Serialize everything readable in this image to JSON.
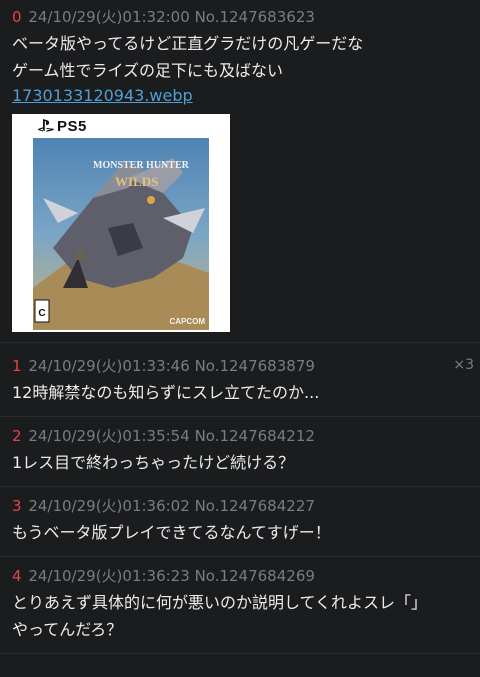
{
  "posts": [
    {
      "index": "0",
      "date": "24/10/29(火)01:32:00",
      "id": "No.1247683623",
      "lines": [
        "ベータ版やってるけど正直グラだけの凡ゲーだな",
        "ゲーム性でライズの足下にも及ばない"
      ],
      "file": "1730133120943.webp",
      "thumbnail": {
        "brand": "PS5",
        "title_line1": "MONSTER HUNTER",
        "title_line2": "WILDS",
        "publisher": "CAPCOM",
        "rating": "C"
      }
    },
    {
      "index": "1",
      "date": "24/10/29(火)01:33:46",
      "id": "No.1247683879",
      "lines": [
        "12時解禁なのも知らずにスレ立てたのか..."
      ],
      "reply_count": "×3"
    },
    {
      "index": "2",
      "date": "24/10/29(火)01:35:54",
      "id": "No.1247684212",
      "lines": [
        "1レス目で終わっちゃったけど続ける？"
      ]
    },
    {
      "index": "3",
      "date": "24/10/29(火)01:36:02",
      "id": "No.1247684227",
      "lines": [
        "もうベータ版プレイできてるなんてすげー！"
      ]
    },
    {
      "index": "4",
      "date": "24/10/29(火)01:36:23",
      "id": "No.1247684269",
      "lines": [
        "とりあえず具体的に何が悪いのか説明してくれよスレ「」",
        "やってんだろ？"
      ]
    }
  ],
  "colors": {
    "background": "#1b1c1e",
    "index": "#e0444a",
    "meta": "#7a7c80",
    "link": "#4f9fd6"
  }
}
